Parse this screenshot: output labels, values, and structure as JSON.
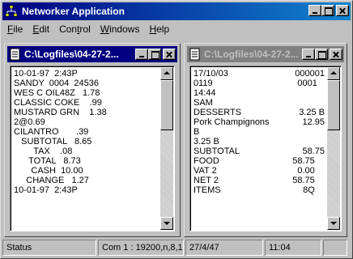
{
  "window": {
    "title": "Networker Application",
    "icon": "network-app-icon"
  },
  "menu": [
    {
      "label": "File",
      "mnemonic": "F",
      "rest": "ile"
    },
    {
      "label": "Edit",
      "mnemonic": "E",
      "rest": "dit"
    },
    {
      "label": "Control",
      "pre": "Con",
      "mnemonic": "t",
      "rest": "rol"
    },
    {
      "label": "Windows",
      "mnemonic": "W",
      "rest": "indows"
    },
    {
      "label": "Help",
      "mnemonic": "H",
      "rest": "elp"
    }
  ],
  "child_left": {
    "title": "C:\\Logfiles\\04-27-2...",
    "active": true,
    "lines": [
      {
        "l": "10-01-97  2:43P",
        "r": ""
      },
      {
        "l": "SANDY  0004  24536",
        "r": ""
      },
      {
        "l": "WES C OIL48Z   1.78",
        "r": ""
      },
      {
        "l": "CLASSIC COKE    .99",
        "r": ""
      },
      {
        "l": "MUSTARD GRN    1.38",
        "r": ""
      },
      {
        "l": "2@0.69",
        "r": ""
      },
      {
        "l": "CILANTRO       .39",
        "r": ""
      },
      {
        "l": "   SUBTOTAL   8.65",
        "r": ""
      },
      {
        "l": "        TAX    .08",
        "r": ""
      },
      {
        "l": "      TOTAL   8.73",
        "r": ""
      },
      {
        "l": "       CASH  10.00",
        "r": ""
      },
      {
        "l": "     CHANGE   1.27",
        "r": ""
      },
      {
        "l": "10-01-97  2:43P",
        "r": ""
      }
    ]
  },
  "child_right": {
    "title": "C:\\Logfiles\\04-27-2...",
    "active": false,
    "lines": [
      {
        "l": "17/10/03",
        "r": "000001"
      },
      {
        "l": "0119",
        "r": "0001   "
      },
      {
        "l": "14:44",
        "r": ""
      },
      {
        "l": "SAM",
        "r": ""
      },
      {
        "l": "DESSERTS",
        "r": "3.25 B"
      },
      {
        "l": "Pork Champignons",
        "r": "12.95"
      },
      {
        "l": "B",
        "r": ""
      },
      {
        "l": "3.25 B",
        "r": ""
      },
      {
        "l": "SUBTOTAL",
        "r": "58.75"
      },
      {
        "l": "FOOD",
        "r": "58.75    "
      },
      {
        "l": "VAT 2",
        "r": "0.00    "
      },
      {
        "l": "NET 2",
        "r": "58.75    "
      },
      {
        "l": "ITEMS",
        "r": "8Q    "
      }
    ]
  },
  "status": {
    "status_label": "Status",
    "com_port": "Com 1 : 19200,n,8,1",
    "date": "27/4/47",
    "time": "11:04",
    "extra": ""
  }
}
